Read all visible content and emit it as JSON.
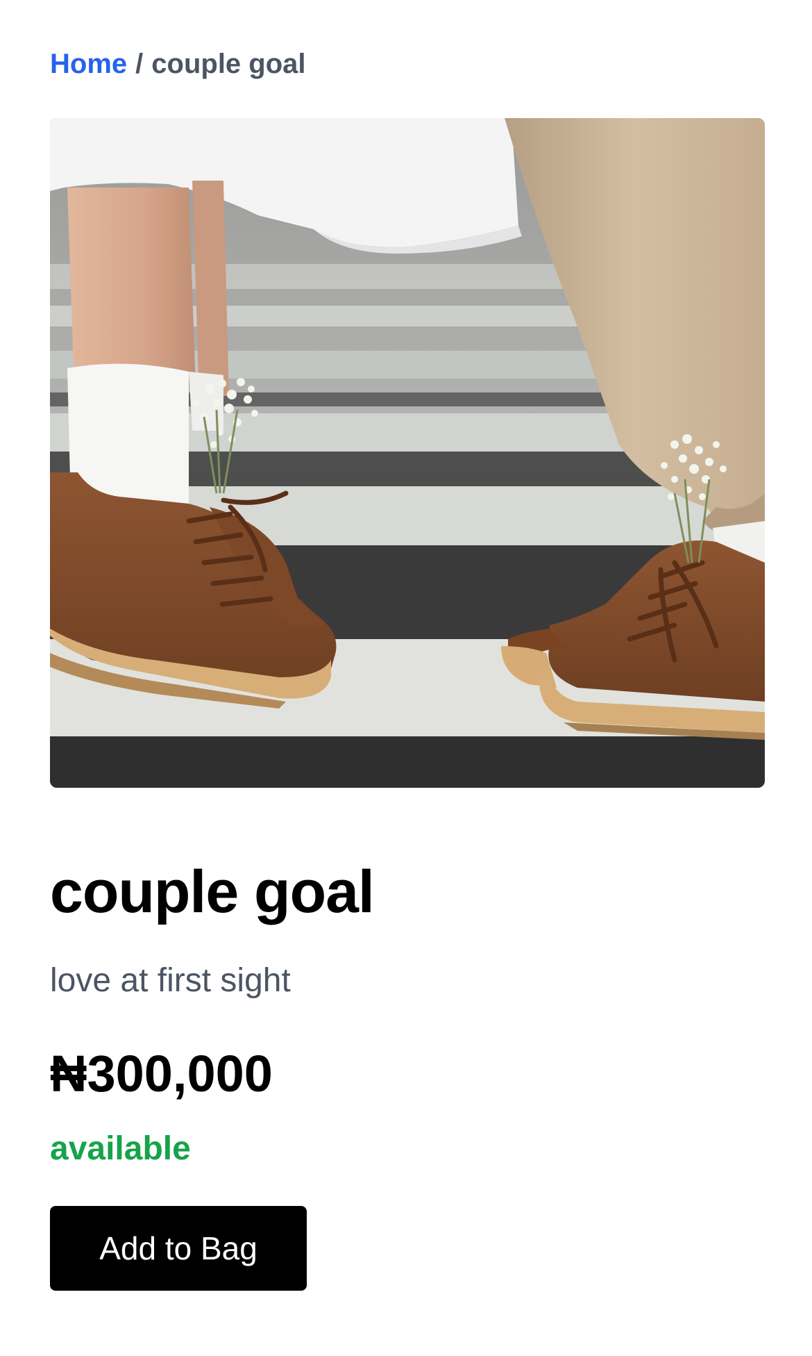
{
  "breadcrumb": {
    "home_label": "Home",
    "separator": "/",
    "current_label": "couple goal"
  },
  "product": {
    "title": "couple goal",
    "subtitle": "love at first sight",
    "price": "₦300,000",
    "availability": "available",
    "image_description": "two pairs of brown high-top sneakers with baby's breath flowers on a crosswalk"
  },
  "actions": {
    "add_to_bag_label": "Add to Bag"
  },
  "colors": {
    "link": "#2563eb",
    "muted_text": "#4b5563",
    "available": "#16a34a",
    "button_bg": "#000000",
    "button_text": "#ffffff"
  }
}
